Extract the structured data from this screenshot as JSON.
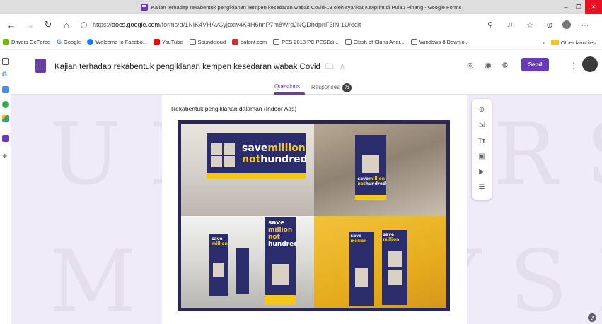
{
  "window": {
    "title": "Kajian terhadap rekabentuk pengiklanan kempen kesedaran wabak Covid-19 oleh syarikat Kaxprint di Pulau Pinang - Google Forms",
    "minimize": "–",
    "maximize": "❐",
    "close": "✕"
  },
  "browser": {
    "url_prefix": "https://",
    "url_domain": "docs.google.com",
    "url_path": "/forms/d/1NIK4VHAvCyjoxw4K4H6nnP7m8WrdJNQDhdpnF3INI1U/edit",
    "bookmarks": [
      {
        "label": "Drivers GeForce",
        "icon": "nvidia-icon"
      },
      {
        "label": "Google",
        "icon": "google-icon"
      },
      {
        "label": "Welcome to Facebo...",
        "icon": "facebook-icon"
      },
      {
        "label": "YouTube",
        "icon": "youtube-icon"
      },
      {
        "label": "Soundcloud",
        "icon": "page-icon"
      },
      {
        "label": "dafont.com",
        "icon": "dafont-icon"
      },
      {
        "label": "PES 2013 PC PESEdi...",
        "icon": "page-icon"
      },
      {
        "label": "Clash of Clans Andr...",
        "icon": "page-icon"
      },
      {
        "label": "Windows 8 Downlo...",
        "icon": "page-icon"
      }
    ],
    "other_favorites": "Other favorites",
    "more_bookmarks": "›"
  },
  "form": {
    "title": "Kajian terhadap rekabentuk pengiklanan kempen kesedaran wabak Covid",
    "send_label": "Send",
    "tabs": {
      "questions": "Questions",
      "responses": "Responses",
      "responses_count": "71"
    },
    "question": {
      "label": "Rekabentuk pengiklanan dalaman (Indoor Ads)"
    }
  },
  "posters": {
    "save": "save",
    "million": "million",
    "not": "not",
    "hundred": "hundred"
  },
  "colors": {
    "accent": "#673ab7",
    "background": "#f0ebf8",
    "poster": "#2b2d6b",
    "poster_highlight": "#f5c518"
  },
  "help": "?"
}
